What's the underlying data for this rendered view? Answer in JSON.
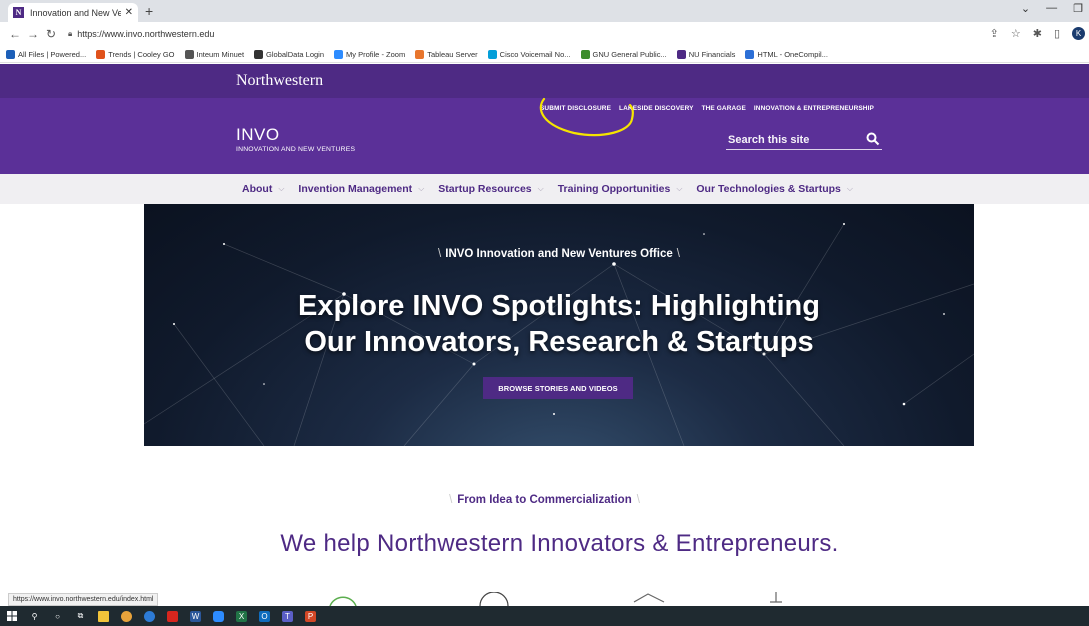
{
  "browser": {
    "tab_title": "Innovation and New Ventures - N",
    "tab_favicon": "N",
    "url": "https://www.invo.northwestern.edu",
    "status_url": "https://www.invo.northwestern.edu/index.html",
    "profile_initial": "K",
    "bookmarks": [
      {
        "label": "All Files | Powered...",
        "icon": "box-icon",
        "color": "#1c5fb8"
      },
      {
        "label": "Trends | Cooley GO",
        "icon": "cooley-icon",
        "color": "#e0521b"
      },
      {
        "label": "Inteum Minuet",
        "icon": "inteum-icon",
        "color": "#555555"
      },
      {
        "label": "GlobalData Login",
        "icon": "globe-icon",
        "color": "#333333"
      },
      {
        "label": "My Profile - Zoom",
        "icon": "zoom-icon",
        "color": "#2d8cff"
      },
      {
        "label": "Tableau Server",
        "icon": "tableau-icon",
        "color": "#e8762d"
      },
      {
        "label": "Cisco Voicemail No...",
        "icon": "cisco-icon",
        "color": "#049fd9"
      },
      {
        "label": "GNU General Public...",
        "icon": "gnu-icon",
        "color": "#3c8c2c"
      },
      {
        "label": "NU Financials",
        "icon": "nu-icon",
        "color": "#4e2a84"
      },
      {
        "label": "HTML - OneCompil...",
        "icon": "onecompiler-icon",
        "color": "#2c6fd6"
      }
    ]
  },
  "site": {
    "university": "Northwestern",
    "logo_big": "INVO",
    "logo_small": "INNOVATION AND NEW VENTURES",
    "utility_nav": [
      "SUBMIT DISCLOSURE",
      "LAKESIDE DISCOVERY",
      "THE GARAGE",
      "INNOVATION & ENTREPRENEURSHIP"
    ],
    "search_placeholder": "Search this site",
    "main_nav": [
      "About",
      "Invention Management",
      "Startup Resources",
      "Training Opportunities",
      "Our Technologies & Startups"
    ],
    "colors": {
      "primary": "#4e2a84",
      "brand_bar": "#5b3098",
      "annotation": "#f5e400"
    }
  },
  "hero": {
    "eyebrow": "INVO Innovation and New Ventures Office",
    "title_line1": "Explore INVO Spotlights: Highlighting",
    "title_line2": "Our Innovators, Research & Startups",
    "button": "BROWSE STORIES AND VIDEOS"
  },
  "section": {
    "eyebrow": "From Idea to Commercialization",
    "title": "We help Northwestern Innovators & Entrepreneurs."
  }
}
